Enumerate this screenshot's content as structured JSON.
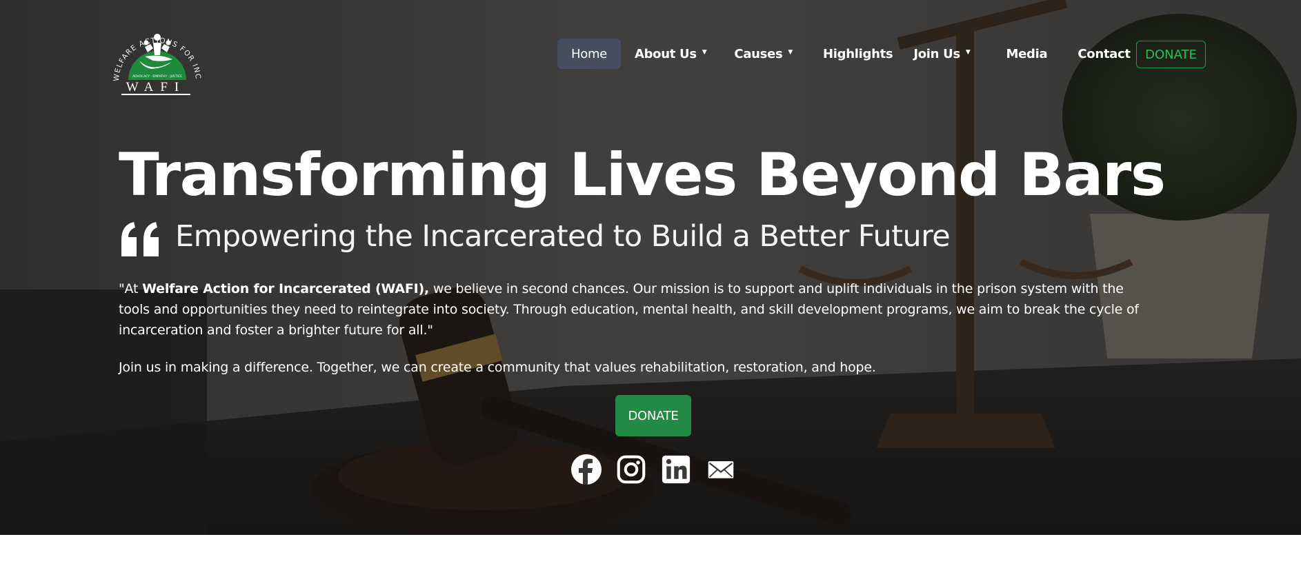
{
  "logo": {
    "arc_text": "WELFARE ACTIONS FOR INCARCERATED",
    "tagline": "ADVOCACY · EMPATHY · JUSTICE",
    "wordmark": "WAFI",
    "icon": "hands-people-logo-icon",
    "brand_color": "#1e8a3c"
  },
  "nav": {
    "items": [
      {
        "label": "Home",
        "active": true,
        "dropdown": false
      },
      {
        "label": "About Us",
        "active": false,
        "dropdown": true
      },
      {
        "label": "Causes",
        "active": false,
        "dropdown": true
      },
      {
        "label": "Highlights",
        "active": false,
        "dropdown": false
      },
      {
        "label": "Join Us",
        "active": false,
        "dropdown": true
      },
      {
        "label": "Media",
        "active": false,
        "dropdown": false
      },
      {
        "label": "Contact",
        "active": false,
        "dropdown": false
      }
    ],
    "donate_label": "DONATE"
  },
  "hero": {
    "headline": "Transforming Lives Beyond Bars",
    "subheadline": "Empowering the Incarcerated to Build a Better Future",
    "para1_prefix": "\"At ",
    "para1_bold": "Welfare Action for Incarcerated (WAFI),",
    "para1_rest": " we believe in second chances. Our mission is to support and uplift individuals in the prison system with the tools and opportunities they need to reintegrate into society. Through education, mental health, and skill development programs, we aim to break the cycle of incarceration and foster a brighter future for all.\"",
    "para2": "Join us in making a difference. Together, we can create a community that values rehabilitation, restoration, and hope.",
    "cta_label": "DONATE",
    "cta_color": "#228a42"
  },
  "social": [
    "facebook-icon",
    "instagram-icon",
    "linkedin-icon",
    "email-icon"
  ]
}
